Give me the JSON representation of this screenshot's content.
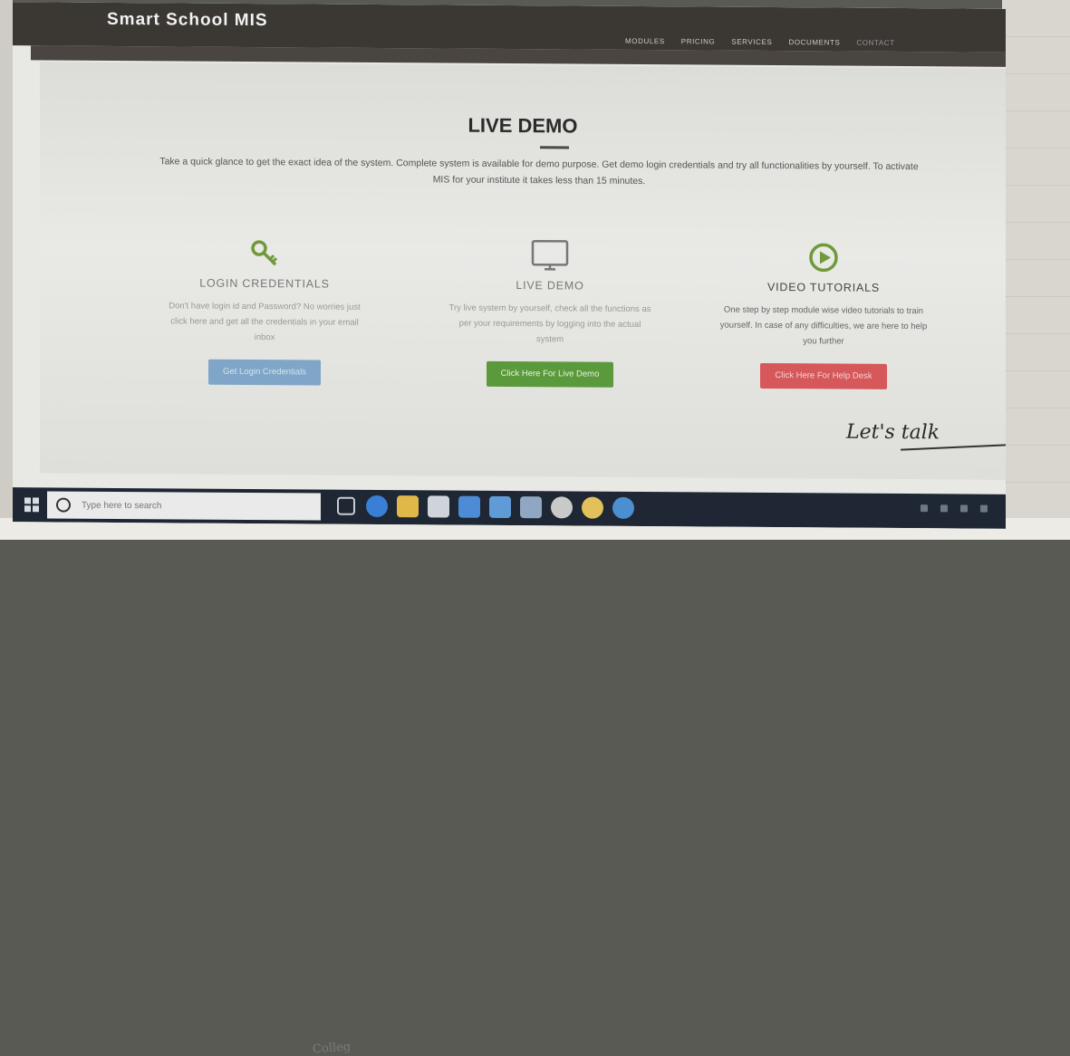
{
  "site": {
    "brand": "Smart School MIS",
    "nav": [
      "MODULES",
      "PRICING",
      "SERVICES",
      "DOCUMENTS",
      "CONTACT"
    ]
  },
  "demo": {
    "title": "LIVE DEMO",
    "intro": "Take a quick glance to get the exact idea of the system. Complete system is available for demo purpose. Get demo login credentials and try all functionalities by yourself. To activate MIS for your institute it takes less than 15 minutes.",
    "columns": [
      {
        "icon": "key-icon",
        "heading": "LOGIN CREDENTIALS",
        "text": "Don't have login id and Password? No worries just click here and get all the credentials in your email inbox",
        "button": "Get Login Credentials",
        "color": "#7fa6c8"
      },
      {
        "icon": "monitor-icon",
        "heading": "LIVE DEMO",
        "text": "Try live system by yourself, check all the functions as per your requirements by logging into the actual system",
        "button": "Click Here For Live Demo",
        "color": "#5b9a3c"
      },
      {
        "icon": "play-circle-icon",
        "heading": "VIDEO TUTORIALS",
        "text": "One step by step module wise video tutorials to train yourself. In case of any difficulties, we are here to help you further",
        "button": "Click Here For Help Desk",
        "color": "#d6585a"
      }
    ],
    "signature": "Let's talk"
  },
  "taskbar": {
    "search_placeholder": "Type here to search"
  },
  "photo": {
    "note": "Colleg"
  }
}
